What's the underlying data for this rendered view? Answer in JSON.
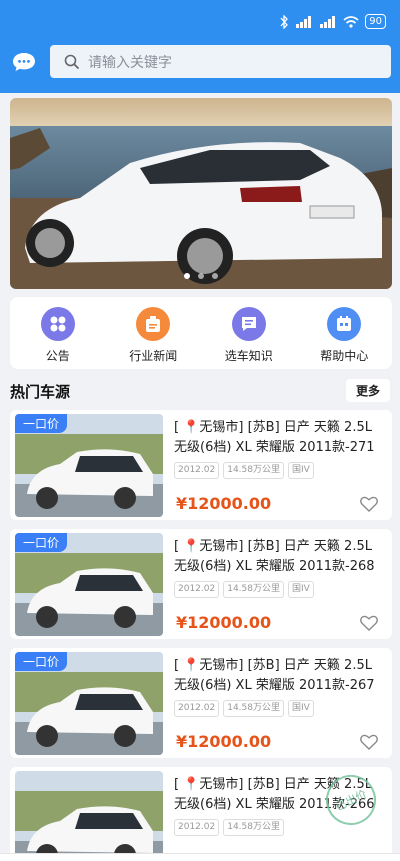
{
  "status_bar": {
    "battery": "90"
  },
  "search": {
    "placeholder": "请输入关键字"
  },
  "quick_links": [
    {
      "label": "公告",
      "color": "#7b78e8",
      "icon": "grid-icon"
    },
    {
      "label": "行业新闻",
      "color": "#f58a3c",
      "icon": "news-icon"
    },
    {
      "label": "选车知识",
      "color": "#7b78e8",
      "icon": "chat-bubble-icon"
    },
    {
      "label": "帮助中心",
      "color": "#4f8ff3",
      "icon": "calendar-icon"
    }
  ],
  "section": {
    "title": "热门车源",
    "more": "更多"
  },
  "listings": [
    {
      "tag": "一口价",
      "title": "[ 📍无锡市] [苏B] 日产 天籁 2.5L 无级(6档) XL 荣耀版 2011款-271",
      "year": "2012.02",
      "mileage": "14.58万公里",
      "emission": "国IV",
      "price": "¥12000.00"
    },
    {
      "tag": "一口价",
      "title": "[ 📍无锡市] [苏B] 日产 天籁 2.5L 无级(6档) XL 荣耀版 2011款-268",
      "year": "2012.02",
      "mileage": "14.58万公里",
      "emission": "国IV",
      "price": "¥12000.00"
    },
    {
      "tag": "一口价",
      "title": "[ 📍无锡市] [苏B] 日产 天籁 2.5L 无级(6档) XL 荣耀版 2011款-267",
      "year": "2012.02",
      "mileage": "14.58万公里",
      "emission": "国IV",
      "price": "¥12000.00"
    },
    {
      "tag": "",
      "title": "[ 📍无锡市] [苏B] 日产 天籁 2.5L 无级(6档) XL 荣耀版 2011款-266",
      "year": "2012.02",
      "mileage": "14.58万公里",
      "emission": "",
      "price": "",
      "stamp": "已出价"
    }
  ]
}
